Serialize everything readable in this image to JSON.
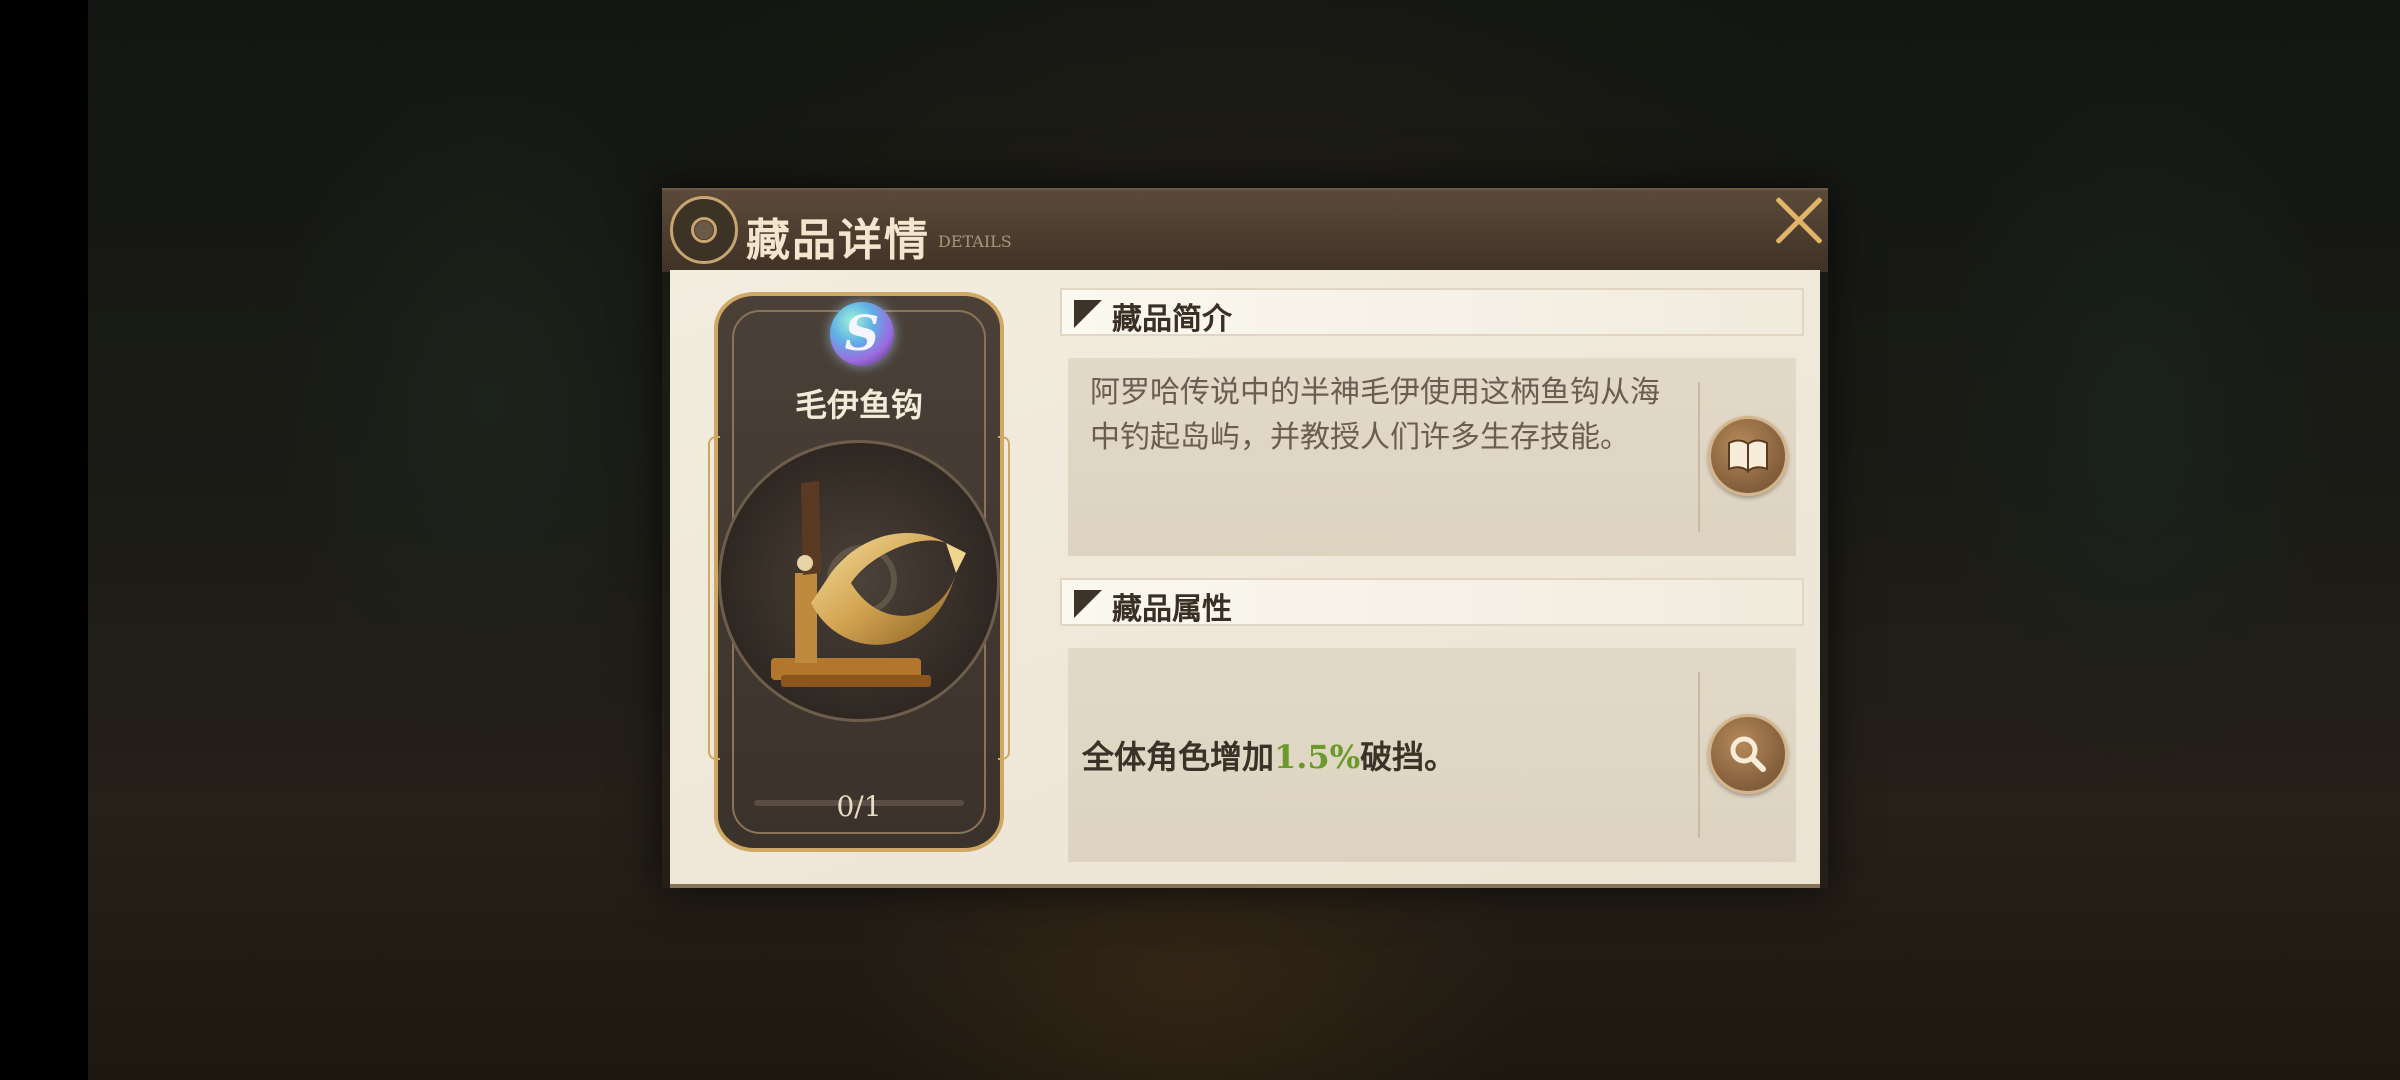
{
  "dialog": {
    "title": "藏品详情",
    "subtitle": "DETAILS",
    "close_icon": "close-icon"
  },
  "card": {
    "rarity": "S",
    "name": "毛伊鱼钩",
    "count": "0/1"
  },
  "intro": {
    "title": "藏品简介",
    "text": "阿罗哈传说中的半神毛伊使用这柄鱼钩从海中钓起岛屿，并教授人们许多生存技能。",
    "icon": "book-icon"
  },
  "attributes": {
    "title": "藏品属性",
    "text_before": "全体角色增加",
    "value": "1.5%",
    "text_after": "破挡。",
    "value_color": "#6a9a2c",
    "icon": "magnifier-icon"
  },
  "colors": {
    "accent_gold": "#e2b46a",
    "header_brown": "#4a3c2e",
    "panel_bg": "#ece4d3"
  }
}
